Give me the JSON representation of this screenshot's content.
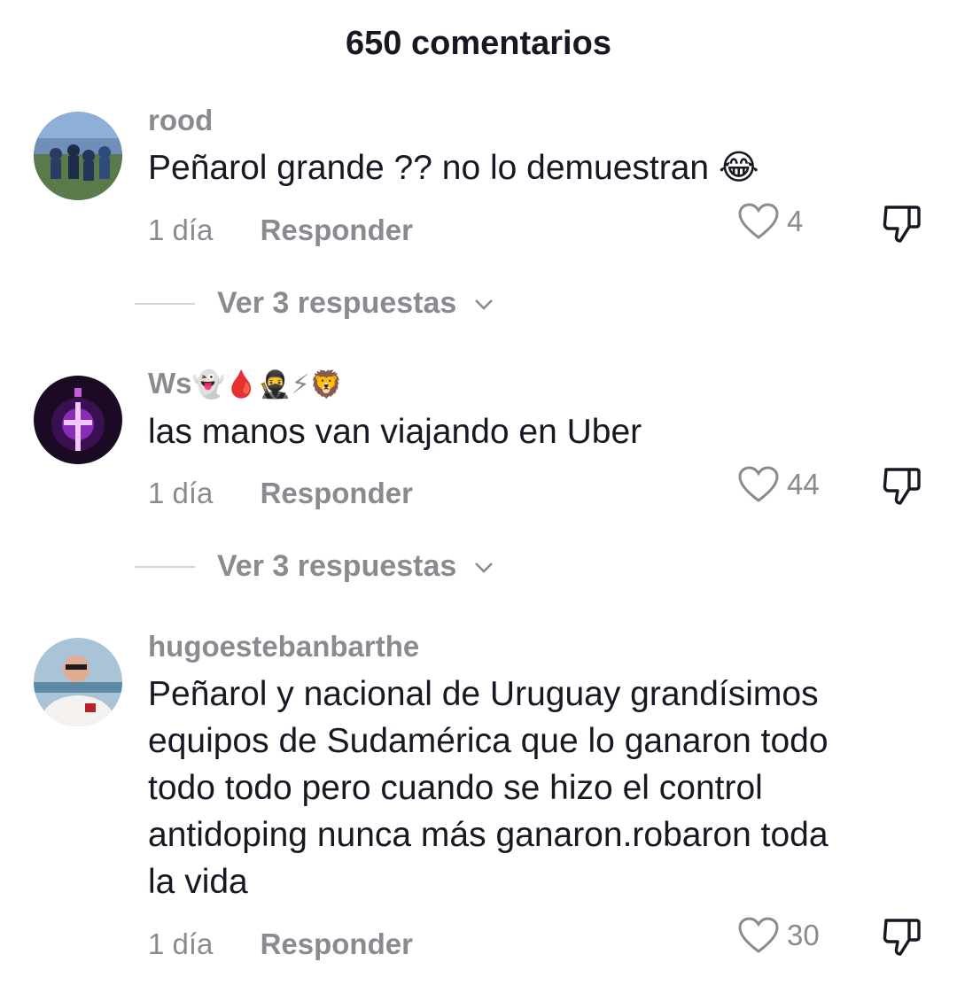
{
  "header": {
    "title": "650 comentarios"
  },
  "comments": [
    {
      "username": "rood",
      "username_emojis": "",
      "text": "Peñarol grande ?? no lo demuestran 😂",
      "time": "1 día",
      "reply_label": "Responder",
      "likes": "4",
      "replies_label": "Ver 3 respuestas"
    },
    {
      "username": "Ws",
      "username_emojis": "👻🩸🥷⚡🦁",
      "text": "las manos van viajando en Uber",
      "time": "1 día",
      "reply_label": "Responder",
      "likes": "44",
      "replies_label": "Ver 3 respuestas"
    },
    {
      "username": "hugoestebanbarthe",
      "username_emojis": "",
      "text": "Peñarol y nacional de Uruguay grandísimos\nequipos de Sudamérica que lo ganaron todo\ntodo todo pero cuando se hizo el control\nantidoping nunca más ganaron.robaron toda\nla vida",
      "time": "1 día",
      "reply_label": "Responder",
      "likes": "30"
    }
  ],
  "icons": {
    "like": "heart-outline-icon",
    "dislike": "thumbs-down-outline-icon",
    "expand": "chevron-down-icon"
  },
  "colors": {
    "text": "#161823",
    "secondary": "#8a8b91",
    "divider": "#d6d6d8",
    "background": "#ffffff"
  }
}
